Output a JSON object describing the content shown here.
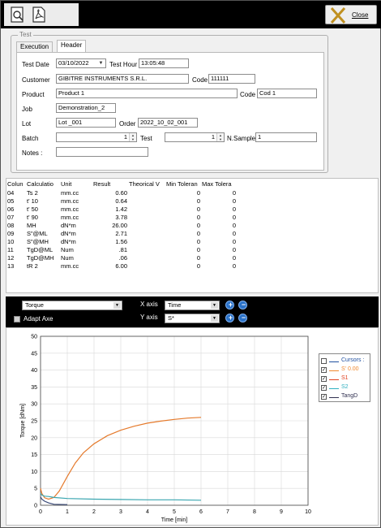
{
  "window": {
    "close_label": "Close"
  },
  "icons": [
    "search-document-icon",
    "pdf-icon",
    "close-x-icon"
  ],
  "group": {
    "title": "Test",
    "tabs": [
      "Execution",
      "Header"
    ],
    "active_tab": "Header"
  },
  "form": {
    "test_date_label": "Test Date",
    "test_date_value": "03/10/2022",
    "test_hour_label": "Test Hour",
    "test_hour_value": "13:05:48",
    "customer_label": "Customer",
    "customer_value": "GIBITRE INSTRUMENTS S.R.L.",
    "code_label": "Code",
    "customer_code_value": "111111",
    "product_label": "Product",
    "product_value": "Product 1",
    "product_code_value": "Cod 1",
    "job_label": "Job",
    "job_value": "Demonstration_2",
    "lot_label": "Lot",
    "lot_value": "Lot _001",
    "order_label": "Order",
    "order_value": "2022_10_02_001",
    "batch_label": "Batch",
    "batch_value": "1",
    "test_label": "Test",
    "test_value": "1",
    "nsample_label": "N.Sample",
    "nsample_value": "1",
    "notes_label": "Notes  :",
    "notes_value": ""
  },
  "results": {
    "headers": [
      "Colun",
      "Calculatio",
      "Unit",
      "Result",
      "Theorical V",
      "Min Toleran",
      "Max Tolera"
    ],
    "rows": [
      [
        "04",
        "Ts 2",
        "mm.cc",
        "0.60",
        "",
        "0",
        "0"
      ],
      [
        "05",
        "t' 10",
        "mm.cc",
        "0.64",
        "",
        "0",
        "0"
      ],
      [
        "06",
        "t' 50",
        "mm.cc",
        "1.42",
        "",
        "0",
        "0"
      ],
      [
        "07",
        "t' 90",
        "mm.cc",
        "3.78",
        "",
        "0",
        "0"
      ],
      [
        "08",
        "MH",
        "dN*m",
        "26.00",
        "",
        "0",
        "0"
      ],
      [
        "09",
        "S\"@ML",
        "dN*m",
        "2.71",
        "",
        "0",
        "0"
      ],
      [
        "10",
        "S\"@MH",
        "dN*m",
        "1.56",
        "",
        "0",
        "0"
      ],
      [
        "11",
        "TgD@ML",
        "Num",
        ".81",
        "",
        "0",
        "0"
      ],
      [
        "12",
        "TgD@MH",
        "Num",
        ".06",
        "",
        "0",
        "0"
      ],
      [
        "13",
        "tR 2",
        "mm.cc",
        "6.00",
        "",
        "0",
        "0"
      ]
    ]
  },
  "chart_toolbar": {
    "graph_select": "Torque",
    "adapt_axe_label": "Adapt Axe",
    "x_axis_label": "X axis",
    "x_axis_value": "Time",
    "y_axis_label": "Y axis",
    "y_axis_value": "S*"
  },
  "legend": [
    {
      "name": "Cursors :",
      "checked": false,
      "color": "#2050a0"
    },
    {
      "name": "S'   0.00",
      "checked": true,
      "color": "#f08a30"
    },
    {
      "name": "S1",
      "checked": true,
      "color": "#e04020"
    },
    {
      "name": "S2",
      "checked": true,
      "color": "#30b0c0"
    },
    {
      "name": "TangD",
      "checked": true,
      "color": "#303050"
    }
  ],
  "chart_data": {
    "type": "line",
    "xlabel": "Time [min]",
    "ylabel": "Torque [dNm]",
    "xlim": [
      0,
      10
    ],
    "ylim": [
      0,
      50
    ],
    "xticks": [
      "0",
      "1",
      "2",
      "3",
      "4",
      "5",
      "6",
      "7",
      "8",
      "9",
      "10"
    ],
    "yticks": [
      "0",
      "5",
      "10",
      "15",
      "20",
      "25",
      "30",
      "35",
      "40",
      "45",
      "50"
    ],
    "grid": true,
    "series": [
      {
        "name": "S1",
        "color": "#e57a2c",
        "x": [
          0,
          0.05,
          0.15,
          0.3,
          0.5,
          0.7,
          1.0,
          1.3,
          1.6,
          2.0,
          2.5,
          3.0,
          3.5,
          4.0,
          4.5,
          5.0,
          5.5,
          6.0
        ],
        "y": [
          5.0,
          3.5,
          2.2,
          1.8,
          2.3,
          4.2,
          8.5,
          12.5,
          15.5,
          18.2,
          20.6,
          22.2,
          23.4,
          24.3,
          24.9,
          25.4,
          25.8,
          26.0
        ]
      },
      {
        "name": "S2",
        "color": "#3aa6b0",
        "x": [
          0,
          0.05,
          0.15,
          0.3,
          0.5,
          1.0,
          2.0,
          3.0,
          4.0,
          5.0,
          6.0
        ],
        "y": [
          3.5,
          3.0,
          2.7,
          2.6,
          2.3,
          2.0,
          1.8,
          1.7,
          1.6,
          1.6,
          1.5
        ]
      },
      {
        "name": "TangD",
        "color": "#3a4a78",
        "x": [
          0,
          0.05,
          0.15,
          0.3,
          0.5,
          1.0
        ],
        "y": [
          2.5,
          1.8,
          1.2,
          0.7,
          0.3,
          0.2
        ]
      }
    ]
  }
}
